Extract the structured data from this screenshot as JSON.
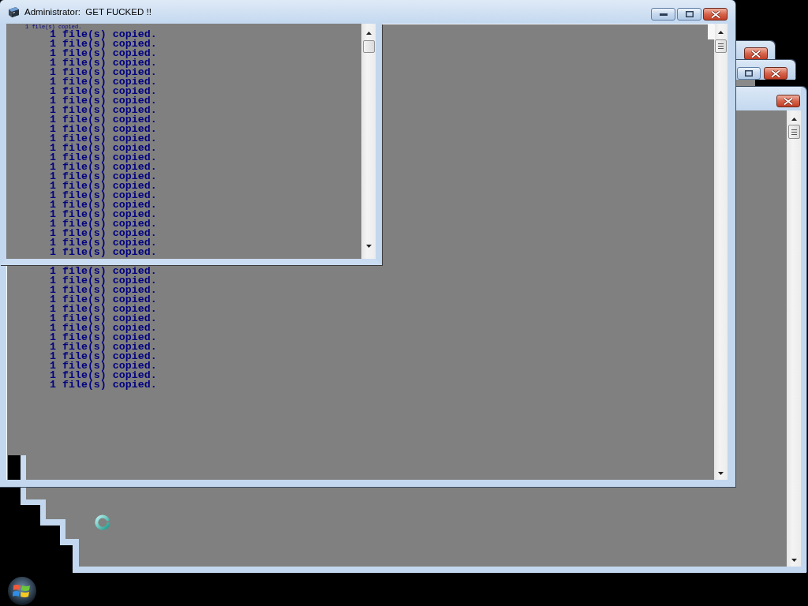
{
  "main_window": {
    "title": "Administrator:  GET FUCKED !!",
    "overlay_pane": {
      "small_text": "1 file(s) copied.",
      "lines": [
        "1 file(s) copied.",
        "1 file(s) copied.",
        "1 file(s) copied.",
        "1 file(s) copied.",
        "1 file(s) copied.",
        "1 file(s) copied.",
        "1 file(s) copied.",
        "1 file(s) copied.",
        "1 file(s) copied.",
        "1 file(s) copied.",
        "1 file(s) copied.",
        "1 file(s) copied.",
        "1 file(s) copied.",
        "1 file(s) copied.",
        "1 file(s) copied.",
        "1 file(s) copied.",
        "1 file(s) copied.",
        "1 file(s) copied.",
        "1 file(s) copied.",
        "1 file(s) copied.",
        "1 file(s) copied.",
        "1 file(s) copied.",
        "1 file(s) copied.",
        "1 file(s) copied."
      ]
    },
    "console": {
      "lines": [
        "1 file(s) copied.",
        "1 file(s) copied.",
        "1 file(s) copied.",
        "1 file(s) copied.",
        "1 file(s) copied.",
        "1 file(s) copied.",
        "1 file(s) copied.",
        "1 file(s) copied.",
        "1 file(s) copied.",
        "1 file(s) copied.",
        "1 file(s) copied.",
        "1 file(s) copied.",
        "1 file(s) copied."
      ]
    }
  }
}
